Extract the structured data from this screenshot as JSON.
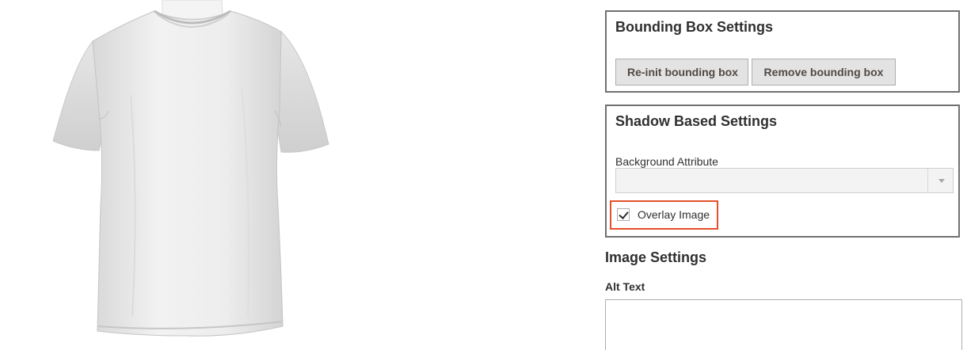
{
  "product_image": {
    "icon": "tshirt-image",
    "color": "#e9e9e9"
  },
  "bounding_box": {
    "title": "Bounding Box Settings",
    "reinit_label": "Re-init bounding box",
    "remove_label": "Remove bounding box"
  },
  "shadow": {
    "title": "Shadow Based Settings",
    "background_attribute_label": "Background Attribute",
    "background_attribute_value": "",
    "overlay_label": "Overlay Image",
    "overlay_checked": true,
    "highlight_color": "#e3502b"
  },
  "image_settings": {
    "title": "Image Settings",
    "alt_text_label": "Alt Text",
    "alt_text_value": ""
  }
}
